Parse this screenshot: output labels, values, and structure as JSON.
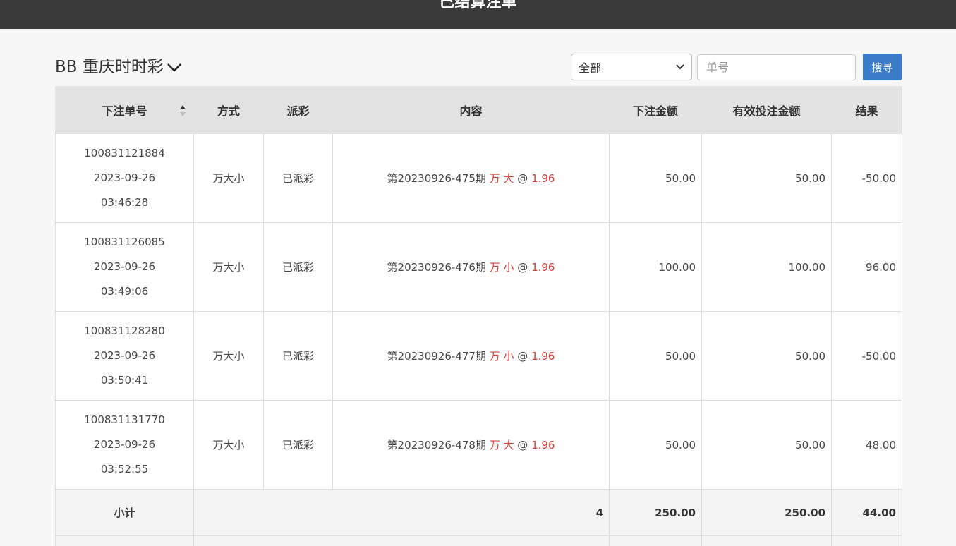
{
  "header": {
    "title": "已结算注单"
  },
  "game": {
    "title": "BB 重庆时时彩"
  },
  "filter": {
    "selected": "全部"
  },
  "search": {
    "placeholder": "单号",
    "button_label": "搜寻"
  },
  "table": {
    "headers": [
      "下注单号",
      "方式",
      "派彩",
      "内容",
      "下注金额",
      "有效投注金额",
      "结果"
    ],
    "rows": [
      {
        "order_no": "100831121884",
        "date": "2023-09-26",
        "time": "03:46:28",
        "method": "万大小",
        "payout": "已派彩",
        "period": "第20230926-475期",
        "pick": "万 大",
        "at": "@",
        "odds": "1.96",
        "amount": "50.00",
        "valid": "50.00",
        "result": "-50.00"
      },
      {
        "order_no": "100831126085",
        "date": "2023-09-26",
        "time": "03:49:06",
        "method": "万大小",
        "payout": "已派彩",
        "period": "第20230926-476期",
        "pick": "万 小",
        "at": "@",
        "odds": "1.96",
        "amount": "100.00",
        "valid": "100.00",
        "result": "96.00"
      },
      {
        "order_no": "100831128280",
        "date": "2023-09-26",
        "time": "03:50:41",
        "method": "万大小",
        "payout": "已派彩",
        "period": "第20230926-477期",
        "pick": "万 小",
        "at": "@",
        "odds": "1.96",
        "amount": "50.00",
        "valid": "50.00",
        "result": "-50.00"
      },
      {
        "order_no": "100831131770",
        "date": "2023-09-26",
        "time": "03:52:55",
        "method": "万大小",
        "payout": "已派彩",
        "period": "第20230926-478期",
        "pick": "万 大",
        "at": "@",
        "odds": "1.96",
        "amount": "50.00",
        "valid": "50.00",
        "result": "48.00"
      }
    ],
    "subtotal": {
      "label": "小计",
      "count": "4",
      "amount": "250.00",
      "valid": "250.00",
      "result": "44.00"
    }
  },
  "colors": {
    "header_bar": "#3a3a3a",
    "accent_button": "#3a7cc9",
    "highlight_red": "#d9413a",
    "table_header": "#e3e3e3"
  }
}
